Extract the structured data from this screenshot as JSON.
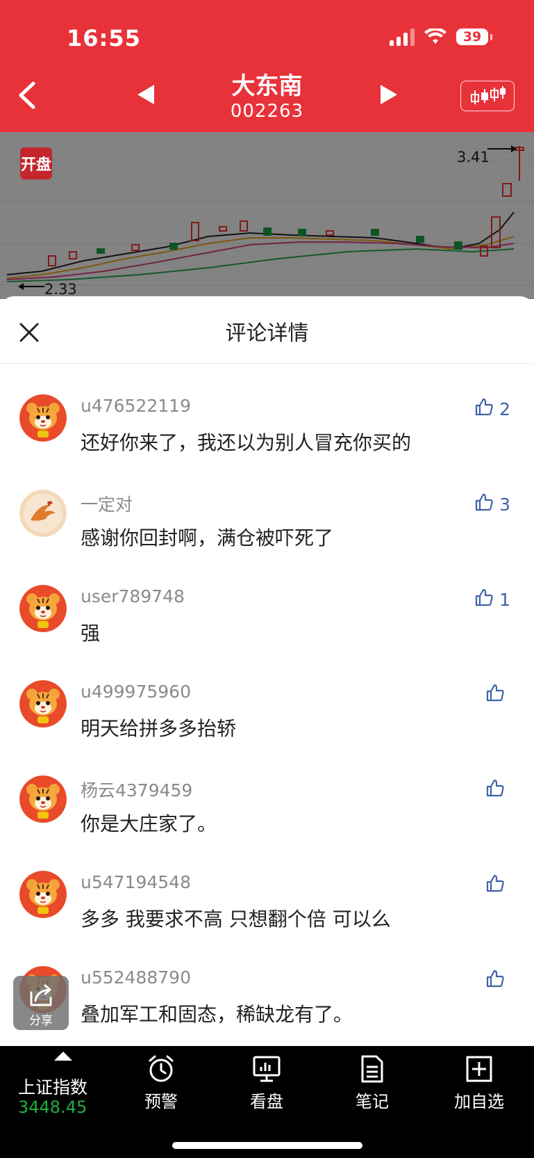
{
  "status_bar": {
    "time": "16:55",
    "battery": "39"
  },
  "header": {
    "stock_name": "大东南",
    "stock_code": "002263"
  },
  "chart": {
    "open_badge": "开盘",
    "high_label": "3.41",
    "low_label": "2.33"
  },
  "sheet": {
    "title": "评论详情"
  },
  "comments": [
    {
      "user": "u476522119",
      "text": "还好你来了，我还以为别人冒充你买的",
      "likes": "2"
    },
    {
      "user": "一定对",
      "text": "感谢你回封啊，满仓被吓死了",
      "likes": "3"
    },
    {
      "user": "user789748",
      "text": "强",
      "likes": "1"
    },
    {
      "user": "u499975960",
      "text": "明天给拼多多抬轿",
      "likes": ""
    },
    {
      "user": "杨云4379459",
      "text": "你是大庄家了。",
      "likes": ""
    },
    {
      "user": "u547194548",
      "text": "多多 我要求不高 只想翻个倍 可以么",
      "likes": ""
    },
    {
      "user": "u552488790",
      "text": "叠加军工和固态，稀缺龙有了。",
      "likes": ""
    }
  ],
  "share": {
    "label": "分享"
  },
  "bottom_bar": {
    "index_name": "上证指数",
    "index_value": "3448.45",
    "tools": [
      "预警",
      "看盘",
      "笔记",
      "加自选"
    ]
  },
  "colors": {
    "header_red": "#e8323a",
    "like_blue": "#3f62a8",
    "index_green": "#1fb040"
  }
}
